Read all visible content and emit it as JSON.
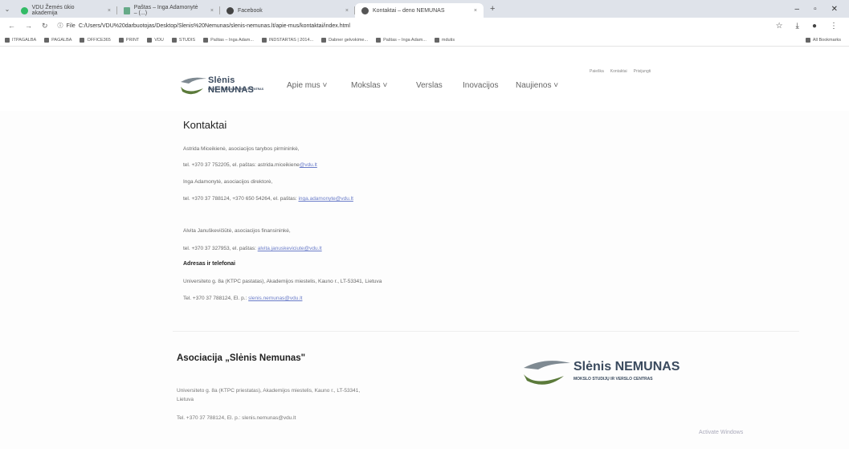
{
  "browser": {
    "tabs": [
      {
        "label": "VDU Žemės ūkio akademija",
        "active": false
      },
      {
        "label": "Paštas – Inga Adamonytė – (...)",
        "active": false
      },
      {
        "label": "Facebook",
        "active": false
      },
      {
        "label": "Kontaktai – deno NEMUNAS",
        "active": true
      }
    ],
    "new_tab": "+",
    "url_prefix": "File",
    "url": "C:/Users/VDU%20darbuotojas/Desktop/Slenis%20Nemunas/slenis-nemunas.lt/apie-mus/kontaktai/index.html",
    "bookmarks": [
      "ITPAGALBA",
      "PAGALBA",
      "OFFICE365",
      "PRINT",
      "VDU",
      "STUDIS",
      "Paštas – Inga Adam...",
      "INDSTARTAS | 2014...",
      "Dabner gelvokime...",
      "Paštas – Inga Adam...",
      "mdutis"
    ],
    "all_bookmarks": "All Bookmarks"
  },
  "site": {
    "brand": "Slėnis NEMUNAS",
    "tagline": "MOKSLO STUDIJŲ IR VERSLO CENTRAS",
    "toplinks": [
      "Paieška",
      "Kontaktai",
      "Prisijungti"
    ],
    "menu": [
      "Apie mus ˅",
      "Mokslas ˅",
      "Verslas",
      "Inovacijos",
      "Naujienos ˅"
    ]
  },
  "contacts": {
    "title": "Kontaktai",
    "lines": {
      "chair": "Astrida Miceikienė, asociacijos tarybos pirmininkė,",
      "chair_tel": "tel. +370 37 752205, el. paštas: astrida.miceikiene",
      "chair_email_domain": "@vdu.lt",
      "director": "Inga Adamonytė, asociacijos direktorė,",
      "director_tel": "tel. +370 37 788124, +370 650 54264, el. paštas: ",
      "director_email": "inga.adamonyte@vdu.lt",
      "finance": "Alvita Januškevičiūtė, asociacijos finansininkė,",
      "finance_tel": "tel. +370 37 327953, el. paštas: ",
      "finance_email": "alvita.januskeviciute@vdu.lt",
      "address_heading": "Adresas ir telefonai",
      "address": "Universiteto g. 8a (KTPC pastatas), Akademijos miestelis, Kauno r., LT-53341, Lietuva",
      "phone": "Tel. +370 37 788124, El. p.: ",
      "phone_email": "slenis.nemunas@vdu.lt"
    }
  },
  "footer": {
    "title": "Asociacija „Slėnis Nemunas\"",
    "address1": "Universiteto g. 8a (KTPC priestatas), Akademijos miestelis, Kauno r., LT-53341,",
    "address2": "Lietuva",
    "phone": "Tel. +370 37 788124, El. p.: slenis.nemunas@vdu.lt",
    "brand": "Slėnis NEMUNAS",
    "tagline": "MOKSLO STUDIJŲ IR VERSLO CENTRAS"
  },
  "watermark": "Activate Windows"
}
